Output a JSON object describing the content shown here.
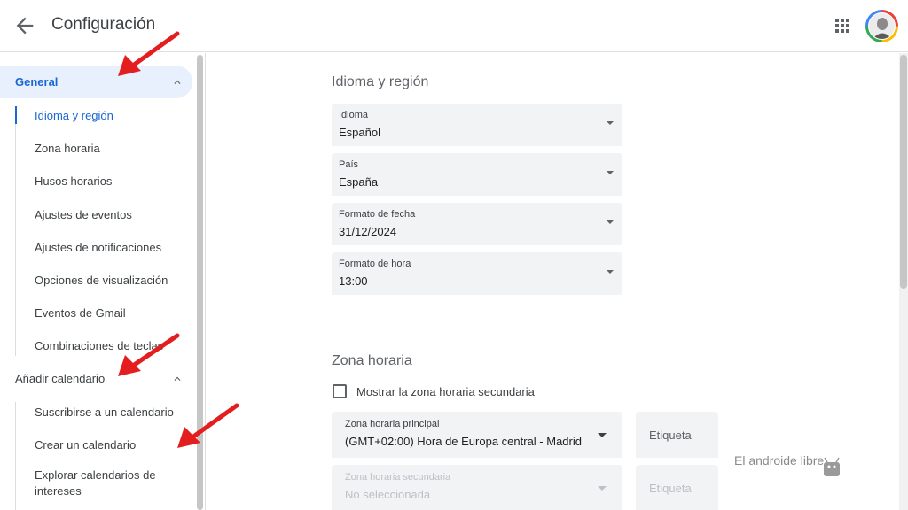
{
  "header": {
    "title": "Configuración",
    "back_icon": "arrow-left-icon",
    "apps_icon": "apps-grid-icon"
  },
  "sidebar": {
    "general": {
      "label": "General"
    },
    "general_items": [
      {
        "label": "Idioma y región",
        "selected": true
      },
      {
        "label": "Zona horaria"
      },
      {
        "label": "Husos horarios"
      },
      {
        "label": "Ajustes de eventos"
      },
      {
        "label": "Ajustes de notificaciones"
      },
      {
        "label": "Opciones de visualización"
      },
      {
        "label": "Eventos de Gmail"
      },
      {
        "label": "Combinaciones de teclas"
      }
    ],
    "add_calendar": {
      "label": "Añadir calendario"
    },
    "add_items": [
      {
        "label": "Suscribirse a un calendario"
      },
      {
        "label": "Crear un calendario"
      },
      {
        "label": "Explorar calendarios de"
      },
      {
        "label": "intereses"
      }
    ]
  },
  "main": {
    "lang_section": {
      "title": "Idioma y región"
    },
    "fields": [
      {
        "label": "Idioma",
        "value": "Español"
      },
      {
        "label": "País",
        "value": "España"
      },
      {
        "label": "Formato de fecha",
        "value": "31/12/2024"
      },
      {
        "label": "Formato de hora",
        "value": "13:00"
      }
    ],
    "tz_section": {
      "title": "Zona horaria",
      "checkbox_label": "Mostrar la zona horaria secundaria",
      "primary_label": "Zona horaria principal",
      "primary_value": "(GMT+02:00) Hora de Europa central - Madrid",
      "secondary_label": "Zona horaria secundaria",
      "secondary_value": "No seleccionada",
      "tag_label": "Etiqueta"
    }
  },
  "watermark": "El androide libre",
  "colors": {
    "accent": "#1967d2",
    "active_bg": "#e8f0fe",
    "field_bg": "#f1f3f4",
    "arrow": "#e41e1e"
  }
}
